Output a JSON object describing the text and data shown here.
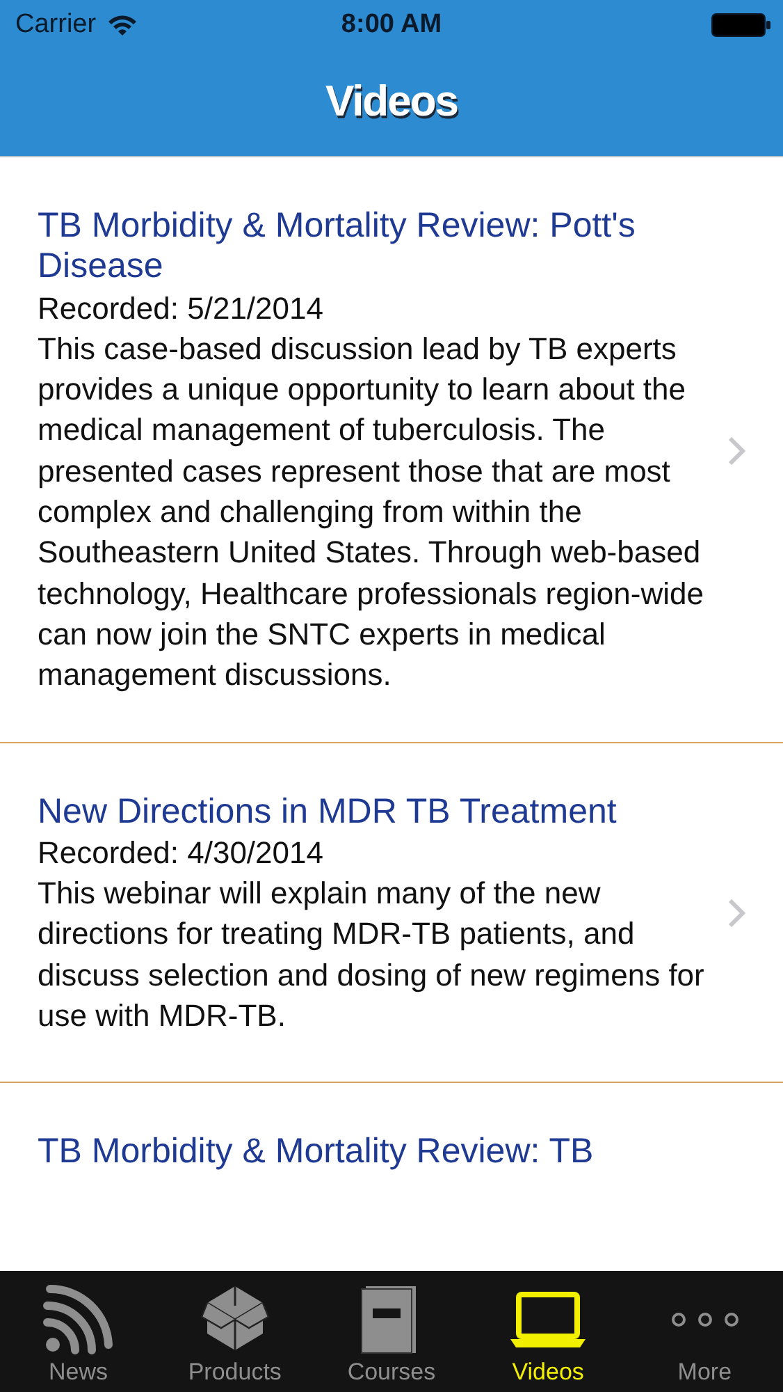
{
  "status_bar": {
    "carrier": "Carrier",
    "time": "8:00 AM"
  },
  "nav_bar": {
    "title": "Videos"
  },
  "videos": [
    {
      "title": "TB Morbidity & Mortality Review: Pott's Disease",
      "recorded": "Recorded: 5/21/2014",
      "description": "This case-based discussion lead by TB experts provides a unique opportunity to learn about the medical management of tuberculosis. The presented cases represent those that are most complex and challenging from within the Southeastern United States. Through web-based technology, Healthcare professionals region-wide can now join the SNTC experts in medical management discussions."
    },
    {
      "title": "New Directions in MDR TB Treatment",
      "recorded": "Recorded: 4/30/2014",
      "description": "This webinar will explain many of the new directions for treating MDR-TB patients, and discuss selection and dosing of new regimens for use with MDR-TB."
    },
    {
      "title": "TB Morbidity & Mortality Review: TB"
    }
  ],
  "tab_bar": [
    {
      "label": "News",
      "kind": "news",
      "selected": false
    },
    {
      "label": "Products",
      "kind": "products",
      "selected": false
    },
    {
      "label": "Courses",
      "kind": "courses",
      "selected": false
    },
    {
      "label": "Videos",
      "kind": "videos",
      "selected": true
    },
    {
      "label": "More",
      "kind": "more",
      "selected": false
    }
  ]
}
